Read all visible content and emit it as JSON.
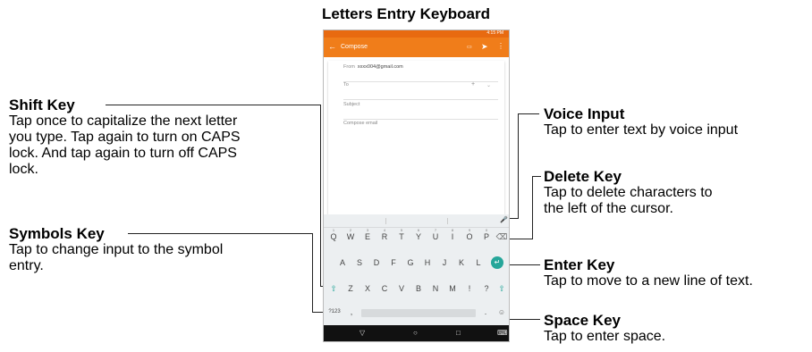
{
  "title": "Letters Entry Keyboard",
  "labels": {
    "shift": {
      "title": "Shift Key",
      "desc": [
        "Tap once to capitalize the next letter",
        "you type. Tap again to turn on CAPS",
        "lock. And tap again to turn off CAPS",
        "lock."
      ]
    },
    "symbols": {
      "title": "Symbols Key",
      "desc": [
        "Tap to change input to the symbol",
        "entry."
      ]
    },
    "voice": {
      "title": "Voice Input",
      "desc": [
        "Tap to enter text by voice input"
      ]
    },
    "delete": {
      "title": "Delete Key",
      "desc": [
        "Tap to delete characters to",
        "the left of the cursor."
      ]
    },
    "enter": {
      "title": "Enter Key",
      "desc": [
        "Tap to move to a new line of text."
      ]
    },
    "space": {
      "title": "Space Key",
      "desc": [
        "Tap to enter space."
      ]
    }
  },
  "phone": {
    "status_time": "4:15 PM",
    "compose_title": "Compose",
    "from_label": "From",
    "from_value": "xxxx004@gmail.com",
    "to_label": "To",
    "subject_placeholder": "Subject",
    "body_placeholder": "Compose email",
    "keyboard": {
      "row1": [
        "Q",
        "W",
        "E",
        "R",
        "T",
        "Y",
        "U",
        "I",
        "O",
        "P"
      ],
      "row1_hints": [
        "1",
        "2",
        "3",
        "4",
        "5",
        "6",
        "7",
        "8",
        "9",
        "0"
      ],
      "row2": [
        "A",
        "S",
        "D",
        "F",
        "G",
        "H",
        "J",
        "K",
        "L"
      ],
      "row3": [
        "Z",
        "X",
        "C",
        "V",
        "B",
        "N",
        "M",
        "!",
        "?"
      ],
      "symbols_label": "?123",
      "comma": ",",
      "period": "."
    }
  }
}
